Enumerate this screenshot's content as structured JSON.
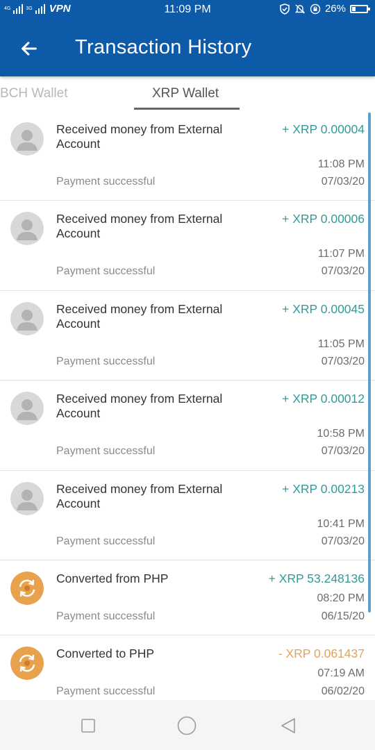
{
  "status_bar": {
    "network_1": "4G",
    "network_2": "3G",
    "vpn": "VPN",
    "time": "11:09 PM",
    "battery": "26%",
    "battery_level": 0.26
  },
  "app_bar": {
    "title": "Transaction History"
  },
  "tabs": [
    {
      "label": "BCH Wallet",
      "active": false
    },
    {
      "label": "XRP Wallet",
      "active": true
    }
  ],
  "transactions": [
    {
      "description": "Received money from External Account",
      "amount": "+ XRP 0.00004",
      "direction": "in",
      "time": "11:08 PM",
      "status": "Payment successful",
      "date": "07/03/20",
      "icon": "user-avatar-icon"
    },
    {
      "description": "Received money from External Account",
      "amount": "+ XRP 0.00006",
      "direction": "in",
      "time": "11:07 PM",
      "status": "Payment successful",
      "date": "07/03/20",
      "icon": "user-avatar-icon"
    },
    {
      "description": "Received money from External Account",
      "amount": "+ XRP 0.00045",
      "direction": "in",
      "time": "11:05 PM",
      "status": "Payment successful",
      "date": "07/03/20",
      "icon": "user-avatar-icon"
    },
    {
      "description": "Received money from External Account",
      "amount": "+ XRP 0.00012",
      "direction": "in",
      "time": "10:58 PM",
      "status": "Payment successful",
      "date": "07/03/20",
      "icon": "user-avatar-icon"
    },
    {
      "description": "Received money from External Account",
      "amount": "+ XRP 0.00213",
      "direction": "in",
      "time": "10:41 PM",
      "status": "Payment successful",
      "date": "07/03/20",
      "icon": "user-avatar-icon"
    },
    {
      "description": "Converted from PHP",
      "amount": "+ XRP 53.248136",
      "direction": "in",
      "time": "08:20 PM",
      "status": "Payment successful",
      "date": "06/15/20",
      "icon": "convert-icon"
    },
    {
      "description": "Converted to PHP",
      "amount": "- XRP 0.061437",
      "direction": "out",
      "time": "07:19 AM",
      "status": "Payment successful",
      "date": "06/02/20",
      "icon": "convert-icon"
    }
  ],
  "colors": {
    "primary": "#0d5aa8",
    "amount_in": "#2f9c9a",
    "amount_out": "#e0a55b",
    "convert_icon_bg": "#e8a24e"
  }
}
